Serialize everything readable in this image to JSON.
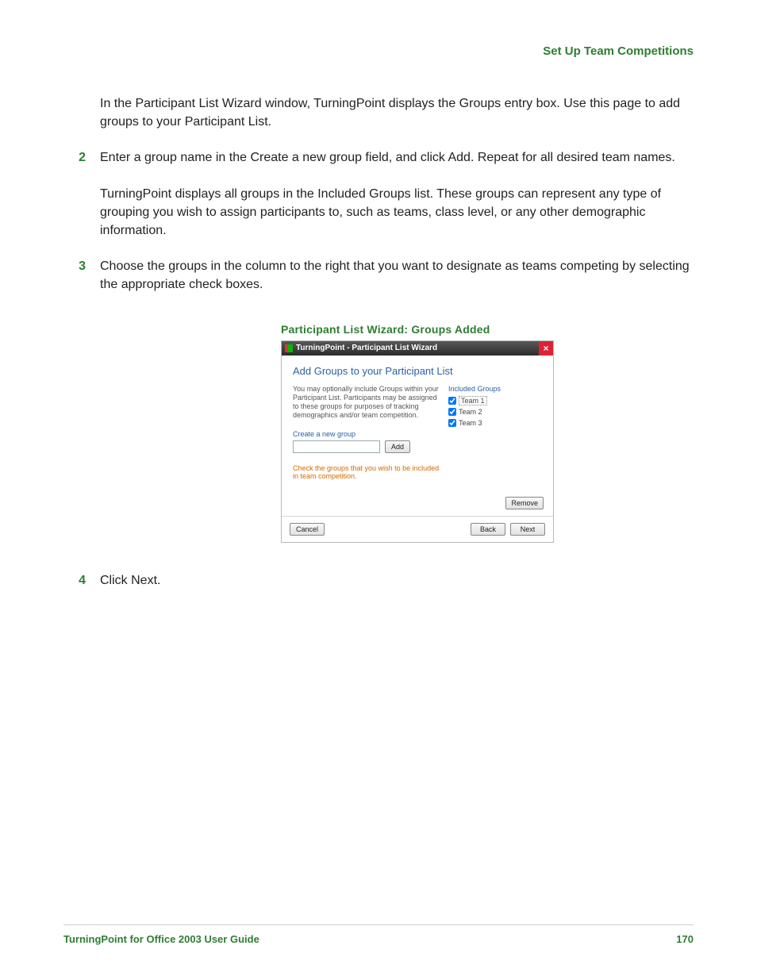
{
  "header": {
    "title": "Set Up Team Competitions"
  },
  "paragraphs": {
    "intro": "In the Participant List Wizard window, TurningPoint displays the Groups entry box. Use this page to add groups to your Participant List.",
    "after2": "TurningPoint displays all groups in the Included Groups list. These groups can represent any type of grouping you wish to assign participants to, such as teams, class level, or any other demographic information."
  },
  "steps": {
    "s2": {
      "num": "2",
      "text": "Enter a group name in the Create a new group field, and click Add. Repeat for all desired team names."
    },
    "s3": {
      "num": "3",
      "text": "Choose the groups in the column to the right that you want to designate as teams competing by selecting the appropriate check boxes."
    },
    "s4": {
      "num": "4",
      "text": "Click Next."
    }
  },
  "figure": {
    "caption": "Participant List Wizard: Groups Added",
    "titlebar": "TurningPoint - Participant List Wizard",
    "heading": "Add Groups to your Participant List",
    "intro": "You may optionally include Groups within your Participant List.  Participants may be assigned to these groups for purposes of tracking demographics and/or team competition.",
    "create_label": "Create a new group",
    "add_label": "Add",
    "check_hint": "Check the groups that you wish to be included in team competition.",
    "included_label": "Included Groups",
    "groups": [
      {
        "label": "Team 1",
        "checked": true,
        "selected": true
      },
      {
        "label": "Team 2",
        "checked": true,
        "selected": false
      },
      {
        "label": "Team 3",
        "checked": true,
        "selected": false
      }
    ],
    "remove_label": "Remove",
    "buttons": {
      "cancel": "Cancel",
      "back": "Back",
      "next": "Next"
    }
  },
  "footer": {
    "label": "TurningPoint for Office 2003 User Guide",
    "page": "170"
  }
}
